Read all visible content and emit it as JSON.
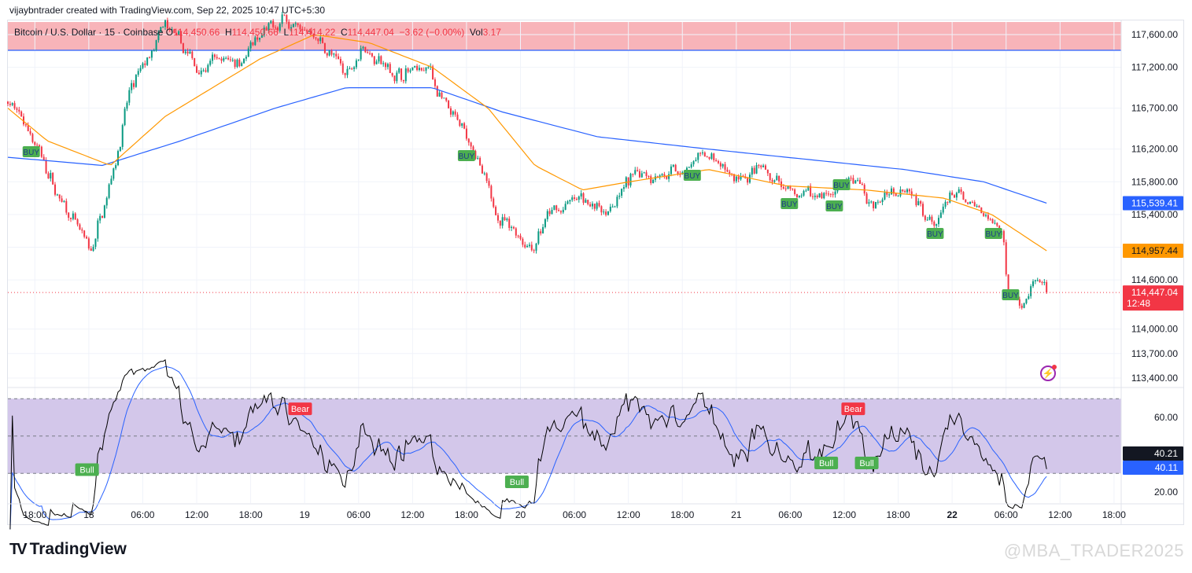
{
  "credit": "vijaybntrader created with TradingView.com, Sep 22, 2025 10:47 UTC+5:30",
  "legend": {
    "symbol": "Bitcoin / U.S. Dollar · 15 · Coinbase",
    "o_label": "O",
    "o": "114,450.66",
    "h_label": "H",
    "h": "114,450.66",
    "l_label": "L",
    "l": "114,414.22",
    "c_label": "C",
    "c": "114,447.04",
    "change": "−3.62 (−0.00%)",
    "vol_label": "Vol",
    "vol": "3.17"
  },
  "branding": {
    "logo": "TradingView",
    "watermark": "@MBA_TRADER2025"
  },
  "colors": {
    "up": "#089981",
    "down": "#f23645",
    "ema_fast": "#ff9800",
    "ema_slow": "#2962ff",
    "rsi_band": "#d1c4e9",
    "rsi_line": "#000000",
    "rsi_signal": "#2962ff",
    "highlight": "#f8b4b9"
  },
  "chart_data": [
    {
      "type": "candlestick",
      "title": "Bitcoin / U.S. Dollar · 15 · Coinbase",
      "interval_minutes": 15,
      "x_unit": "hours since Sep 17 15:00",
      "ylim": [
        113250,
        117800
      ],
      "y_ticks": [
        "117,600.00",
        "117,200.00",
        "116,700.00",
        "116,200.00",
        "115,800.00",
        "115,400.00",
        "115,000.00",
        "114,600.00",
        "114,000.00",
        "113,700.00",
        "113,400.00"
      ],
      "y_tick_values": [
        117600,
        117200,
        116700,
        116200,
        115800,
        115400,
        115000,
        114600,
        114000,
        113700,
        113400
      ],
      "price_path": [
        [
          0,
          116780
        ],
        [
          2.6,
          116400
        ],
        [
          5.25,
          115700
        ],
        [
          9.2,
          114900
        ],
        [
          11.8,
          116000
        ],
        [
          13.6,
          116900
        ],
        [
          17.5,
          117700
        ],
        [
          21,
          117200
        ],
        [
          25.4,
          117300
        ],
        [
          28,
          117500
        ],
        [
          30.6,
          117800
        ],
        [
          34.1,
          117600
        ],
        [
          37.6,
          117100
        ],
        [
          39.4,
          117500
        ],
        [
          42.9,
          117100
        ],
        [
          46.8,
          117200
        ],
        [
          49,
          116600
        ],
        [
          51.6,
          116300
        ],
        [
          53.8,
          115500
        ],
        [
          58.2,
          115000
        ],
        [
          60.4,
          115400
        ],
        [
          63.9,
          115600
        ],
        [
          66.5,
          115450
        ],
        [
          70.4,
          115950
        ],
        [
          74.4,
          115900
        ],
        [
          77.9,
          116100
        ],
        [
          80.9,
          115800
        ],
        [
          84,
          115900
        ],
        [
          87.5,
          115600
        ],
        [
          91.9,
          115700
        ],
        [
          94.5,
          115800
        ],
        [
          96.2,
          115500
        ],
        [
          99.7,
          115800
        ],
        [
          103.2,
          115300
        ],
        [
          105,
          115650
        ],
        [
          108.5,
          115400
        ],
        [
          110.7,
          115200
        ],
        [
          111.1,
          114500
        ],
        [
          112.9,
          114300
        ],
        [
          114.2,
          114650
        ],
        [
          115.5,
          114447
        ]
      ],
      "ema_fast": {
        "name": "EMA (orange)",
        "last": "114,957.44",
        "path": [
          [
            0,
            116700
          ],
          [
            4.4,
            116300
          ],
          [
            11.4,
            116000
          ],
          [
            17.5,
            116600
          ],
          [
            28,
            117300
          ],
          [
            34.1,
            117600
          ],
          [
            40.2,
            117500
          ],
          [
            47.2,
            117200
          ],
          [
            53.4,
            116700
          ],
          [
            58.6,
            116000
          ],
          [
            63.9,
            115700
          ],
          [
            69.1,
            115800
          ],
          [
            77.9,
            115950
          ],
          [
            86.6,
            115750
          ],
          [
            95.4,
            115700
          ],
          [
            104.1,
            115600
          ],
          [
            109.4,
            115400
          ],
          [
            115.5,
            114957
          ]
        ]
      },
      "ema_slow": {
        "name": "EMA (blue)",
        "last": "115,539.41",
        "path": [
          [
            0,
            116100
          ],
          [
            10.5,
            116000
          ],
          [
            19.2,
            116300
          ],
          [
            29.7,
            116700
          ],
          [
            37.6,
            116950
          ],
          [
            47.2,
            116950
          ],
          [
            55.1,
            116650
          ],
          [
            65.6,
            116350
          ],
          [
            77.9,
            116200
          ],
          [
            86.6,
            116100
          ],
          [
            99.7,
            115950
          ],
          [
            108.5,
            115800
          ],
          [
            115.5,
            115539
          ]
        ]
      },
      "resistance_level": 117408,
      "last_price": "114,447.04",
      "countdown": "12:48",
      "buy_signals": [
        [
          2.6,
          116168
        ],
        [
          51,
          116120
        ],
        [
          76.1,
          115880
        ],
        [
          86.9,
          115534
        ],
        [
          91.9,
          115505
        ],
        [
          92.7,
          115764
        ],
        [
          103.1,
          115168
        ],
        [
          109.6,
          115168
        ],
        [
          111.5,
          114419
        ]
      ],
      "buy_label": "BUY",
      "x_ticks": [
        "18:00",
        "18",
        "06:00",
        "12:00",
        "18:00",
        "19",
        "06:00",
        "12:00",
        "18:00",
        "20",
        "06:00",
        "12:00",
        "18:00",
        "21",
        "06:00",
        "12:00",
        "18:00",
        "22",
        "06:00",
        "12:00",
        "18:00"
      ]
    },
    {
      "type": "line",
      "title": "RSI",
      "ylim": [
        15,
        75
      ],
      "band": [
        30,
        70
      ],
      "midline": 50,
      "y_ticks": [
        "60.00",
        "20.00"
      ],
      "y_tick_values": [
        60,
        20
      ],
      "rsi_last": "40.21",
      "signal_last": "40.11",
      "labels": [
        {
          "text": "Bear",
          "h": 32.5,
          "value": 64.6,
          "kind": "bear"
        },
        {
          "text": "Bear",
          "h": 94,
          "value": 64.6,
          "kind": "bear"
        },
        {
          "text": "Bull",
          "h": 8.8,
          "value": 32,
          "kind": "bull"
        },
        {
          "text": "Bull",
          "h": 56.6,
          "value": 25.5,
          "kind": "bull"
        },
        {
          "text": "Bull",
          "h": 91,
          "value": 35.6,
          "kind": "bull"
        },
        {
          "text": "Bull",
          "h": 95.5,
          "value": 35.6,
          "kind": "bull"
        }
      ]
    }
  ]
}
